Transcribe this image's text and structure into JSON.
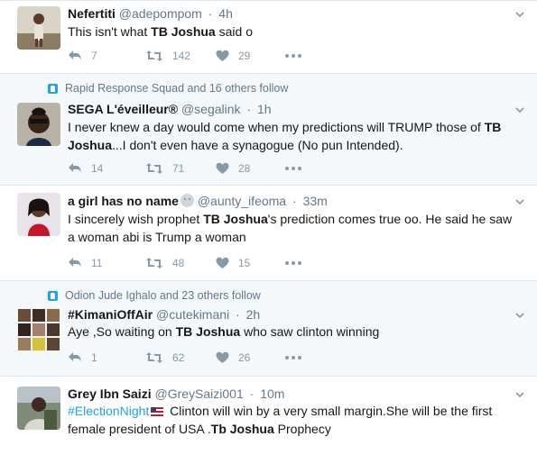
{
  "tweets": [
    {
      "name": "Nefertiti",
      "handle": "@adepompom",
      "time": "4h",
      "text_parts": [
        "This isn't what ",
        "TB Joshua",
        " said o"
      ],
      "reply_count": "7",
      "retweet_count": "142",
      "like_count": "29"
    },
    {
      "context": "Rapid Response Squad and 16 others follow",
      "name": "SEGA L'éveilleur®",
      "handle": "@segalink",
      "time": "1h",
      "text_parts": [
        "I never knew a day would come when my predictions will TRUMP those of ",
        "TB",
        "",
        "Joshua",
        "...I don't even have a synagogue (No pun Intended)."
      ],
      "reply_count": "14",
      "retweet_count": "71",
      "like_count": "28"
    },
    {
      "name": "a girl has no name",
      "handle": "@aunty_ifeoma",
      "time": "33m",
      "text_parts": [
        "I sincerely wish prophet ",
        "TB Joshua",
        "'s prediction comes true oo. He said he saw a woman abi is Trump a woman"
      ],
      "reply_count": "11",
      "retweet_count": "48",
      "like_count": "15"
    },
    {
      "context": "Odion Jude Ighalo and 23 others follow",
      "name": "#KimaniOffAir",
      "handle": "@cutekimani",
      "time": "2h",
      "text_parts": [
        "Aye ,So waiting on ",
        "TB Joshua",
        " who saw clinton winning"
      ],
      "reply_count": "1",
      "retweet_count": "62",
      "like_count": "26"
    },
    {
      "name": "Grey Ibn Saizi",
      "handle": "@GreySaizi001",
      "time": "10m",
      "hashtag": "#ElectionNight",
      "text_parts": [
        " Clinton will win by a very small margin.She will be the first female president of USA .",
        "Tb Joshua",
        " Prophecy"
      ]
    }
  ],
  "dot": "·",
  "colors": {
    "link": "#1da1f2",
    "muted": "#657786",
    "action": "#8899a6",
    "divider": "#e1e8ed",
    "highlight_bg": "#f5f8fa"
  },
  "icons": [
    "reply-icon",
    "retweet-icon",
    "like-icon",
    "more-icon",
    "chevron-down-icon",
    "follow-context-icon"
  ]
}
